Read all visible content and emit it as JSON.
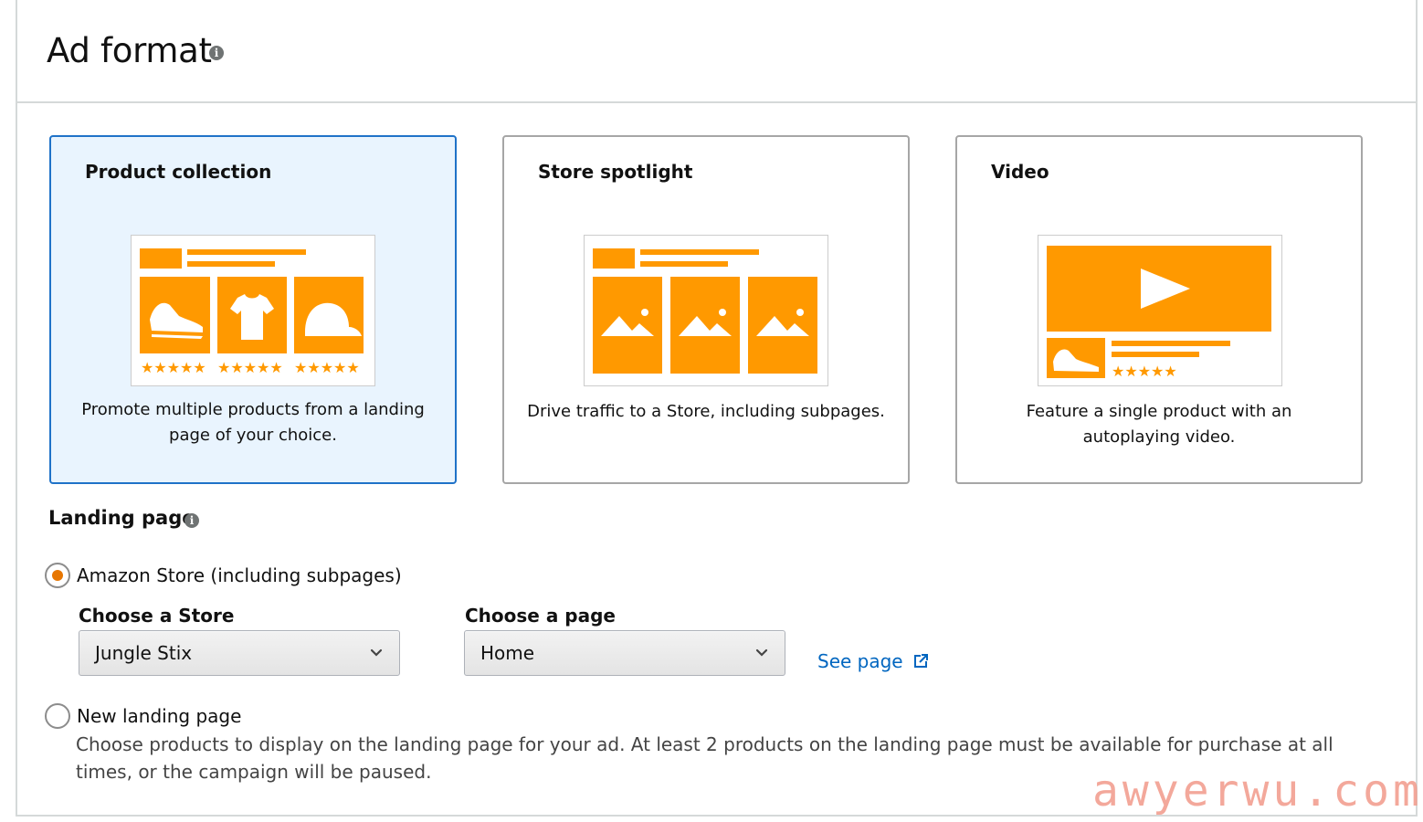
{
  "header": {
    "title": "Ad format"
  },
  "cards": [
    {
      "title": "Product collection",
      "description": "Promote multiple products from a landing page of your choice.",
      "selected": true
    },
    {
      "title": "Store spotlight",
      "description": "Drive traffic to a Store, including subpages.",
      "selected": false
    },
    {
      "title": "Video",
      "description": "Feature a single product with an autoplaying video.",
      "selected": false
    }
  ],
  "landing": {
    "label": "Landing page",
    "option_store": "Amazon Store (including subpages)",
    "choose_store_label": "Choose a Store",
    "store_value": "Jungle Stix",
    "choose_page_label": "Choose a page",
    "page_value": "Home",
    "see_page": "See page",
    "option_new": "New landing page",
    "new_help": "Choose products to display on the landing page for your ad. At least 2 products on the landing page must be available for purchase at all times, or the campaign will be paused."
  },
  "watermark": "awyerwu.com",
  "colors": {
    "accent_orange": "#ff9900",
    "selected_border": "#1f72c8",
    "selected_bg": "#e9f4fe",
    "link": "#0066c0"
  },
  "icons": [
    "info-icon",
    "chevron-down-icon",
    "external-link-icon",
    "shoe-icon",
    "tshirt-icon",
    "cap-icon",
    "image-icon",
    "play-icon",
    "star-icon"
  ]
}
